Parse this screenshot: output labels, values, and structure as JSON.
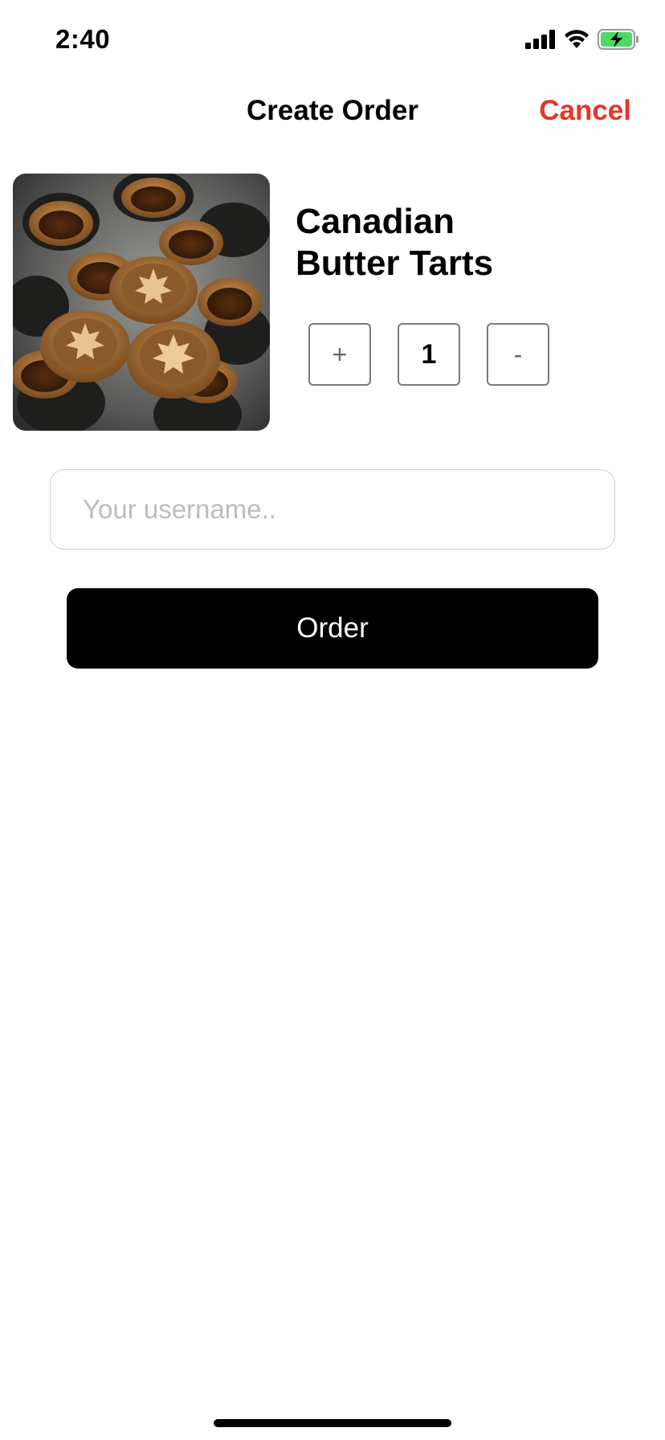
{
  "status_bar": {
    "time": "2:40",
    "battery_color": "#4cd964"
  },
  "nav": {
    "title": "Create Order",
    "cancel_label": "Cancel",
    "cancel_color": "#e5352a"
  },
  "product": {
    "name_line1": "Canadian",
    "name_line2": "Butter Tarts",
    "image_icon": "butter-tarts-photo"
  },
  "stepper": {
    "plus_label": "+",
    "quantity": "1",
    "minus_label": "-"
  },
  "form": {
    "username_value": "",
    "username_placeholder": "Your username..",
    "order_label": "Order"
  }
}
